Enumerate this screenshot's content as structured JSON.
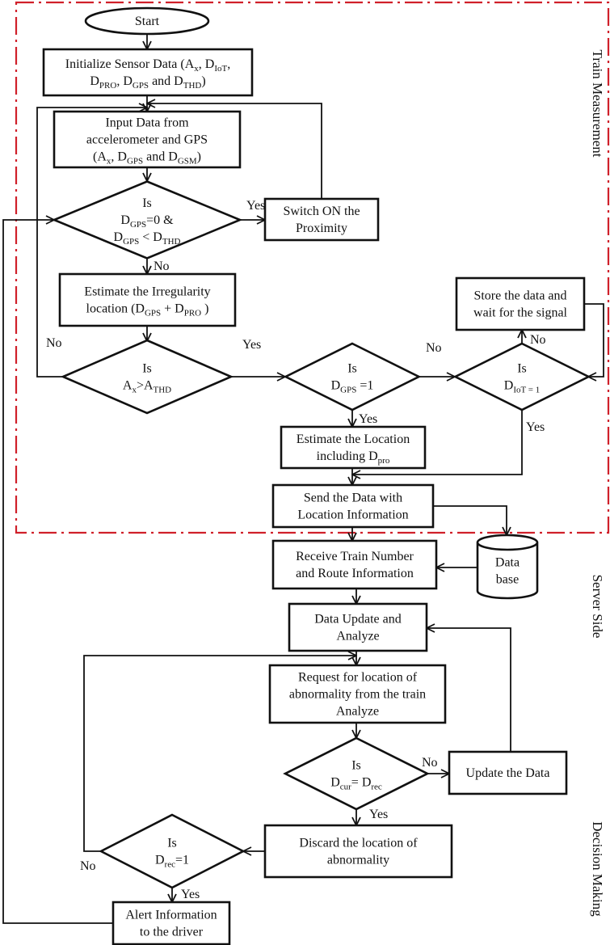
{
  "colors": {
    "region_border": "#d0202a",
    "line": "#111111"
  },
  "regions": {
    "train_measurement": "Train Measurement",
    "server_side": "Server Side",
    "decision_making": "Decision Making"
  },
  "nodes": {
    "start": {
      "lines": [
        [
          {
            "t": "Start"
          }
        ]
      ]
    },
    "init": {
      "lines": [
        [
          {
            "t": "Initialize Sensor Data (A"
          },
          {
            "sub": "x"
          },
          {
            "t": ", D"
          },
          {
            "sub": "IoT"
          },
          {
            "t": ","
          }
        ],
        [
          {
            "t": "D"
          },
          {
            "sub": "PRO"
          },
          {
            "t": ", D"
          },
          {
            "sub": "GPS"
          },
          {
            "t": " and D"
          },
          {
            "sub": "THD"
          },
          {
            "t": ")"
          }
        ]
      ]
    },
    "input": {
      "lines": [
        [
          {
            "t": "Input Data from"
          }
        ],
        [
          {
            "t": "accelerometer and GPS"
          }
        ],
        [
          {
            "t": "(A"
          },
          {
            "sub": "x"
          },
          {
            "t": ", D"
          },
          {
            "sub": "GPS"
          },
          {
            "t": " and D"
          },
          {
            "sub": "GSM"
          },
          {
            "t": ")"
          }
        ]
      ]
    },
    "d1": {
      "lines": [
        [
          {
            "t": "Is"
          }
        ],
        [
          {
            "t": "D"
          },
          {
            "sub": "GPS"
          },
          {
            "t": "=0 &"
          }
        ],
        [
          {
            "t": "D"
          },
          {
            "sub": "GPS"
          },
          {
            "t": " < D"
          },
          {
            "sub": "THD"
          }
        ]
      ]
    },
    "switch": {
      "lines": [
        [
          {
            "t": "Switch ON the"
          }
        ],
        [
          {
            "t": "Proximity"
          }
        ]
      ]
    },
    "est_irr": {
      "lines": [
        [
          {
            "t": "Estimate the Irregularity"
          }
        ],
        [
          {
            "t": "location (D"
          },
          {
            "sub": "GPS"
          },
          {
            "t": " + D"
          },
          {
            "sub": "PRO"
          },
          {
            "t": " )"
          }
        ]
      ]
    },
    "d2": {
      "lines": [
        [
          {
            "t": "Is"
          }
        ],
        [
          {
            "t": "A"
          },
          {
            "sub": "x"
          },
          {
            "t": ">A"
          },
          {
            "sub": "THD"
          }
        ]
      ]
    },
    "d3": {
      "lines": [
        [
          {
            "t": "Is"
          }
        ],
        [
          {
            "t": "D"
          },
          {
            "sub": "GPS"
          },
          {
            "t": " =1"
          }
        ]
      ]
    },
    "d4": {
      "lines": [
        [
          {
            "t": "Is"
          }
        ],
        [
          {
            "t": "D"
          },
          {
            "sub": "IoT = 1"
          }
        ]
      ]
    },
    "store": {
      "lines": [
        [
          {
            "t": "Store the data and"
          }
        ],
        [
          {
            "t": "wait for the signal"
          }
        ]
      ]
    },
    "est_loc": {
      "lines": [
        [
          {
            "t": "Estimate the Location"
          }
        ],
        [
          {
            "t": "including D"
          },
          {
            "sub": "pro"
          }
        ]
      ]
    },
    "send": {
      "lines": [
        [
          {
            "t": "Send the Data with"
          }
        ],
        [
          {
            "t": "Location Information"
          }
        ]
      ]
    },
    "receive": {
      "lines": [
        [
          {
            "t": "Receive Train Number"
          }
        ],
        [
          {
            "t": "and Route Information"
          }
        ]
      ]
    },
    "database": {
      "lines": [
        [
          {
            "t": "Data"
          }
        ],
        [
          {
            "t": "base"
          }
        ]
      ]
    },
    "update_analyze": {
      "lines": [
        [
          {
            "t": "Data Update and"
          }
        ],
        [
          {
            "t": "Analyze"
          }
        ]
      ]
    },
    "request": {
      "lines": [
        [
          {
            "t": "Request for location of"
          }
        ],
        [
          {
            "t": "abnormality from the train"
          }
        ],
        [
          {
            "t": "Analyze"
          }
        ]
      ]
    },
    "d5": {
      "lines": [
        [
          {
            "t": "Is"
          }
        ],
        [
          {
            "t": "D"
          },
          {
            "sub": "cur"
          },
          {
            "t": "= D"
          },
          {
            "sub": "rec"
          }
        ]
      ]
    },
    "update": {
      "lines": [
        [
          {
            "t": "Update the Data"
          }
        ]
      ]
    },
    "discard": {
      "lines": [
        [
          {
            "t": "Discard the location of"
          }
        ],
        [
          {
            "t": "abnormality"
          }
        ]
      ]
    },
    "d6": {
      "lines": [
        [
          {
            "t": "Is"
          }
        ],
        [
          {
            "t": "D"
          },
          {
            "sub": "rec"
          },
          {
            "t": "=1"
          }
        ]
      ]
    },
    "alert": {
      "lines": [
        [
          {
            "t": "Alert Information"
          }
        ],
        [
          {
            "t": "to the driver"
          }
        ]
      ]
    }
  },
  "edge_labels": {
    "d1_yes": "Yes",
    "d1_no": "No",
    "d2_no": "No",
    "d2_yes": "Yes",
    "d3_no": "No",
    "d3_yes": "Yes",
    "d4_no": "No",
    "d4_yes": "Yes",
    "d5_no": "No",
    "d5_yes": "Yes",
    "d6_no": "No",
    "d6_yes": "Yes"
  }
}
